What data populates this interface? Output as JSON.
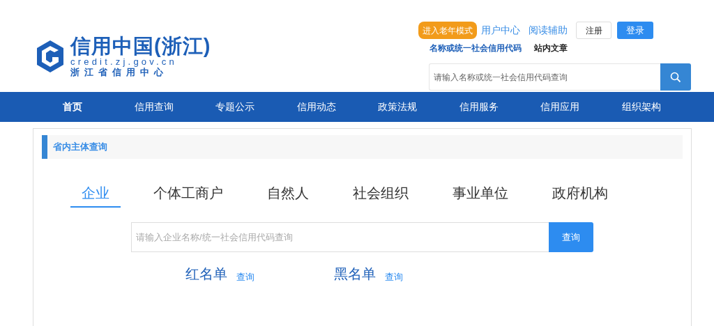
{
  "header": {
    "logo": {
      "title": "信用中国(浙江)",
      "domain": "credit.zj.gov.cn",
      "subtitle": "浙江省信用中心"
    },
    "elder_mode_button": "进入老年模式",
    "links": [
      "用户中心",
      "阅读辅助"
    ],
    "register_button": "注册",
    "login_button": "登录",
    "search_types": [
      {
        "label": "名称或统一社会信用代码",
        "selected": true
      },
      {
        "label": "站内文章",
        "selected": false
      }
    ],
    "search": {
      "placeholder": "请输入名称或统一社会信用代码查询"
    }
  },
  "nav": [
    {
      "label": "首页",
      "selected": true
    },
    {
      "label": "信用查询",
      "selected": false
    },
    {
      "label": "专题公示",
      "selected": false
    },
    {
      "label": "信用动态",
      "selected": false
    },
    {
      "label": "政策法规",
      "selected": false
    },
    {
      "label": "信用服务",
      "selected": false
    },
    {
      "label": "信用应用",
      "selected": false
    },
    {
      "label": "组织架构",
      "selected": false
    }
  ],
  "panel": {
    "title": "省内主体查询",
    "tabs": [
      {
        "label": "企业",
        "selected": true
      },
      {
        "label": "个体工商户",
        "selected": false
      },
      {
        "label": "自然人",
        "selected": false
      },
      {
        "label": "社会组织",
        "selected": false
      },
      {
        "label": "事业单位",
        "selected": false
      },
      {
        "label": "政府机构",
        "selected": false
      }
    ],
    "search": {
      "placeholder": "请输入企业名称/统一社会信用代码查询",
      "button": "查询"
    },
    "lists": [
      {
        "title": "红名单",
        "link": "查询"
      },
      {
        "title": "黑名单",
        "link": "查询"
      }
    ]
  }
}
